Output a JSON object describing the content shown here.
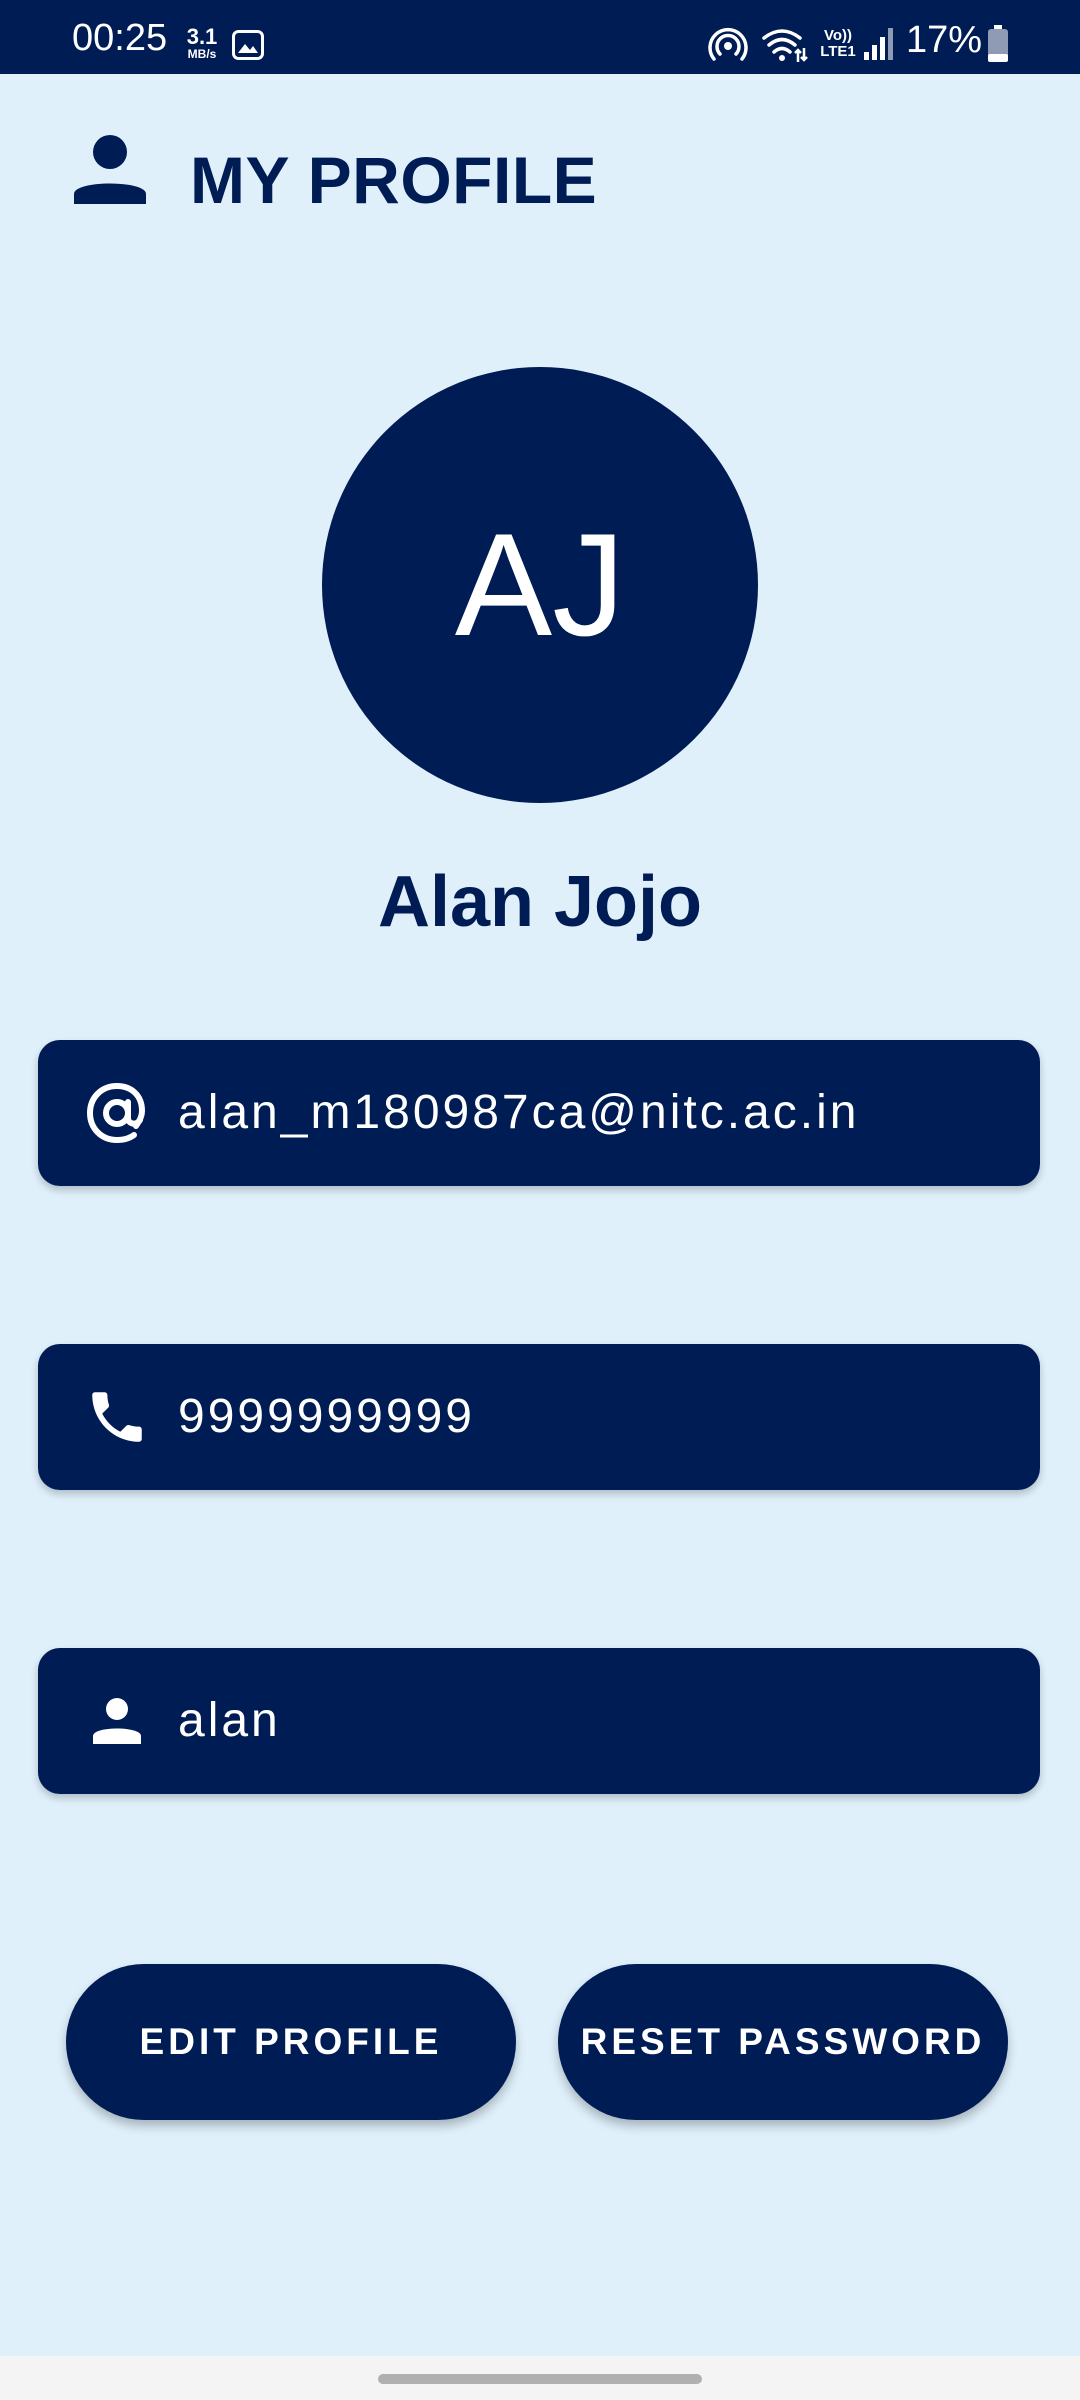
{
  "status_bar": {
    "time": "00:25",
    "speed_value": "3.1",
    "speed_unit": "MB/s",
    "network_label": "Vo)) LTE1",
    "battery": "17%"
  },
  "header": {
    "title": "MY PROFILE",
    "icon": "person-icon"
  },
  "profile": {
    "initials": "AJ",
    "name": "Alan Jojo"
  },
  "fields": {
    "email": {
      "icon": "at-icon",
      "value": "alan_m180987ca@nitc.ac.in"
    },
    "phone": {
      "icon": "phone-icon",
      "value": "9999999999"
    },
    "username": {
      "icon": "person-icon",
      "value": "alan"
    }
  },
  "buttons": {
    "edit_profile": "EDIT PROFILE",
    "reset_password": "RESET PASSWORD"
  },
  "colors": {
    "primary": "#001c54",
    "background": "#dff0fb",
    "on_primary": "#ffffff"
  }
}
